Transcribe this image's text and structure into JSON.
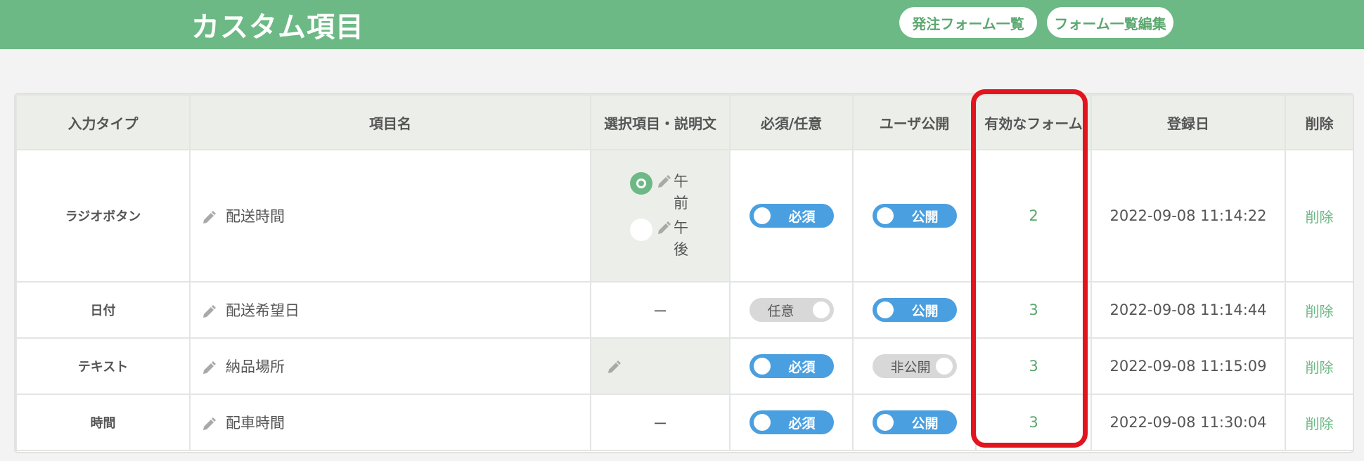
{
  "header": {
    "title": "カスタム項目",
    "button_order_forms": "発注フォーム一覧",
    "button_form_edit": "フォーム一覧編集"
  },
  "table": {
    "columns": [
      "入力タイプ",
      "項目名",
      "選択項目・説明文",
      "必須/任意",
      "ユーザ公開",
      "有効なフォーム",
      "登録日",
      "削除"
    ],
    "rows": [
      {
        "type": "ラジオボタン",
        "name": "配送時間",
        "options": [
          {
            "label": "午前",
            "selected": true
          },
          {
            "label": "午後",
            "selected": false
          }
        ],
        "required": "必須",
        "required_on": true,
        "public": "公開",
        "public_on": true,
        "forms": "2",
        "date": "2022-09-08 11:14:22",
        "delete": "削除"
      },
      {
        "type": "日付",
        "name": "配送希望日",
        "description": "ー",
        "required": "任意",
        "required_on": false,
        "public": "公開",
        "public_on": true,
        "forms": "3",
        "date": "2022-09-08 11:14:44",
        "delete": "削除"
      },
      {
        "type": "テキスト",
        "name": "納品場所",
        "description": "",
        "required": "必須",
        "required_on": true,
        "public": "非公開",
        "public_on": false,
        "forms": "3",
        "date": "2022-09-08 11:15:09",
        "delete": "削除"
      },
      {
        "type": "時間",
        "name": "配車時間",
        "description": "ー",
        "required": "必須",
        "required_on": true,
        "public": "公開",
        "public_on": true,
        "forms": "3",
        "date": "2022-09-08 11:30:04",
        "delete": "削除"
      }
    ]
  },
  "colors": {
    "header_bg": "#6cb985",
    "toggle_on": "#4a9fe0",
    "toggle_off": "#d8d8d8",
    "link_green": "#5aa86f",
    "highlight_red": "#e2151f"
  },
  "icons": {
    "edit": "pencil-icon"
  }
}
